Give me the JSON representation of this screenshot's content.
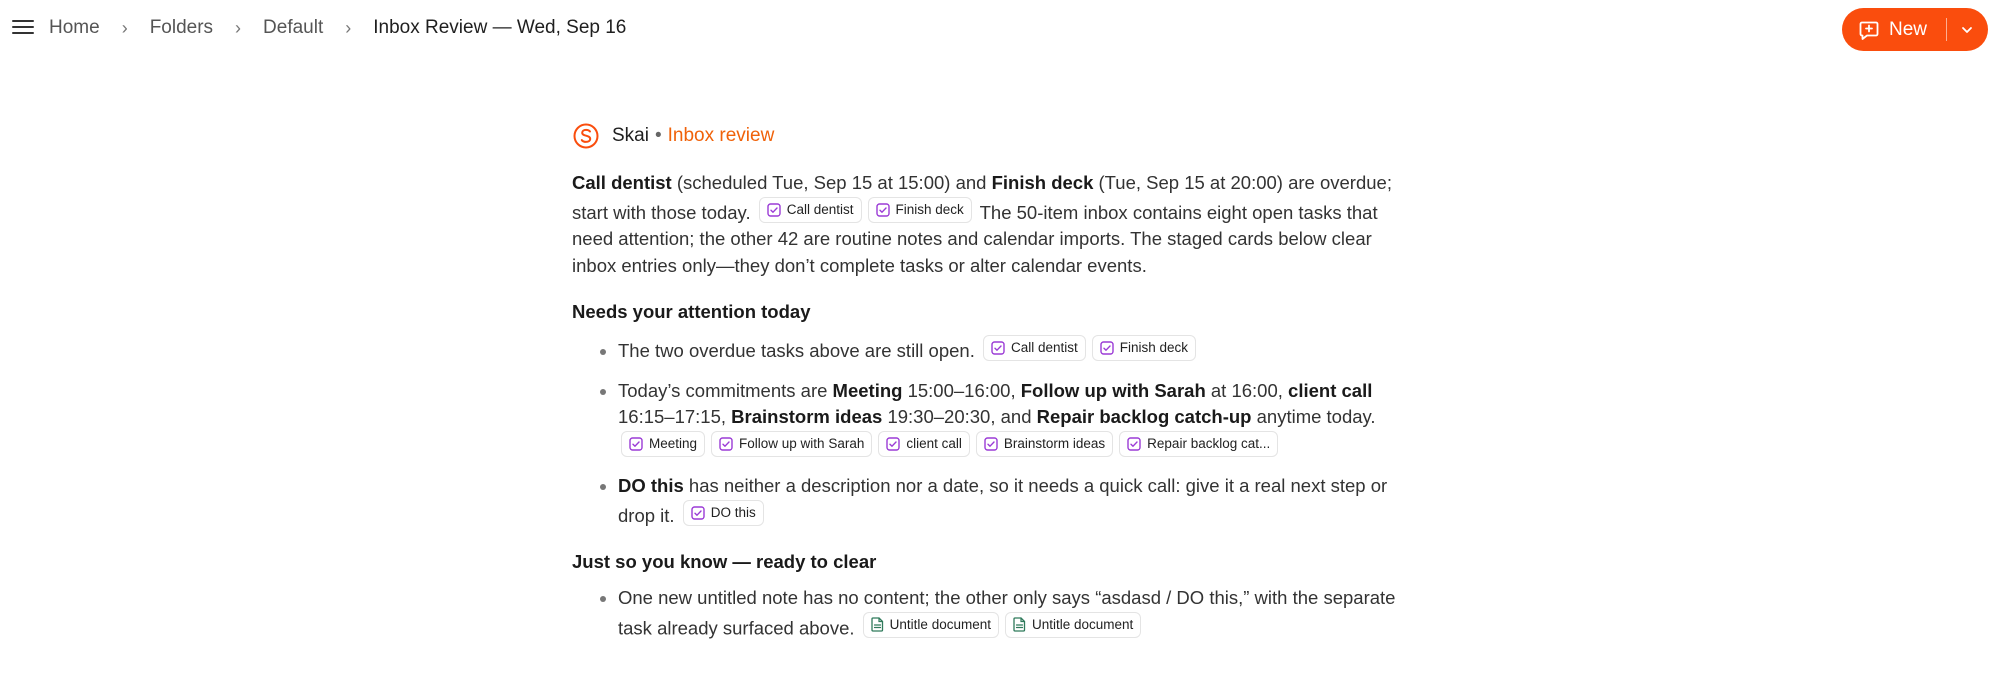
{
  "breadcrumb": {
    "items": [
      "Home",
      "Folders",
      "Default"
    ],
    "current": "Inbox Review — Wed, Sep 16",
    "separator": "›"
  },
  "new_button": {
    "label": "New"
  },
  "colors": {
    "accent": "#fa4d0d",
    "task_icon": "#9b3bd6",
    "doc_icon": "#2f7a5b"
  },
  "author": {
    "name": "Skai",
    "separator": "•",
    "tag": "Inbox review"
  },
  "lead": {
    "t1_bold": "Call dentist",
    "t1_rest": " (scheduled Tue, Sep 15 at 15:00) and ",
    "t2_bold": "Finish deck",
    "t2_rest": " (Tue, Sep 15 at 20:00) are overdue; start with those today.",
    "chips": [
      "Call dentist",
      "Finish deck"
    ],
    "tail": "The 50-item inbox contains eight open tasks that need attention; the other 42 are routine notes and calendar imports. The staged cards below clear inbox entries only—they don’t complete tasks or alter calendar events."
  },
  "section1": {
    "heading": "Needs your attention today",
    "item1": {
      "text": "The two overdue tasks above are still open.",
      "chips": [
        "Call dentist",
        "Finish deck"
      ]
    },
    "item2": {
      "pre": "Today’s commitments are ",
      "b1": "Meeting",
      "s1": " 15:00–16:00, ",
      "b2": "Follow up with Sarah",
      "s2": " at 16:00, ",
      "b3": "client call",
      "s3": " 16:15–17:15, ",
      "b4": "Brainstorm ideas",
      "s4": " 19:30–20:30, and ",
      "b5": "Repair backlog catch-up",
      "s5": " anytime today.",
      "chips": [
        "Meeting",
        "Follow up with Sarah",
        "client call",
        "Brainstorm ideas",
        "Repair backlog cat..."
      ]
    },
    "item3": {
      "bold": "DO this",
      "rest": " has neither a description nor a date, so it needs a quick call: give it a real next step or drop it.",
      "chips": [
        "DO this"
      ]
    }
  },
  "section2": {
    "heading": "Just so you know — ready to clear",
    "item1": {
      "text": "One new untitled note has no content; the other only says “asdasd / DO this,” with the separate task already surfaced above.",
      "chips": [
        "Untitle document",
        "Untitle document"
      ]
    }
  }
}
